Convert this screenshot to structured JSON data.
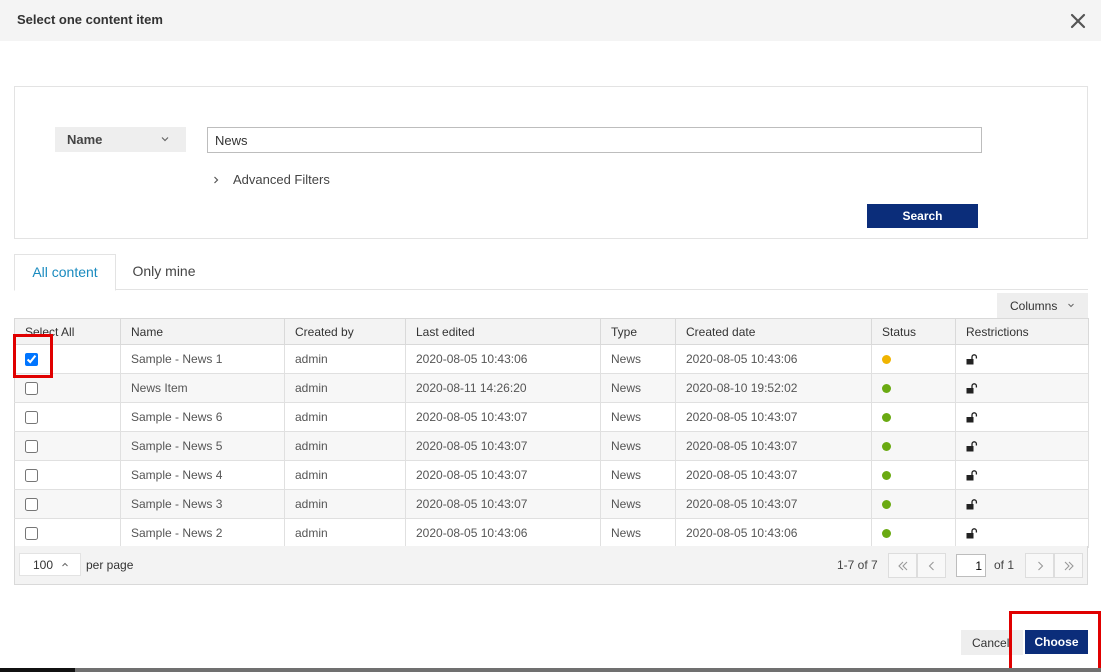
{
  "dialog": {
    "title": "Select one content item",
    "close_icon": "close-icon"
  },
  "filter": {
    "field_label": "Name",
    "search_value": "News",
    "advanced_filters_label": "Advanced Filters",
    "search_button_label": "Search"
  },
  "tabs": [
    {
      "label": "All content",
      "active": true
    },
    {
      "label": "Only mine",
      "active": false
    }
  ],
  "columns_button_label": "Columns",
  "table": {
    "headers": [
      "Select All",
      "Name",
      "Created by",
      "Last edited",
      "Type",
      "Created date",
      "Status",
      "Restrictions"
    ],
    "rows": [
      {
        "checked": true,
        "name": "Sample - News 1",
        "created_by": "admin",
        "last_edited": "2020-08-05 10:43:06",
        "type": "News",
        "created_date": "2020-08-05 10:43:06",
        "status_color": "#f0b400",
        "restriction_icon": "unlock-icon"
      },
      {
        "checked": false,
        "name": "News Item",
        "created_by": "admin",
        "last_edited": "2020-08-11 14:26:20",
        "type": "News",
        "created_date": "2020-08-10 19:52:02",
        "status_color": "#6aaa12",
        "restriction_icon": "unlock-icon"
      },
      {
        "checked": false,
        "name": "Sample - News 6",
        "created_by": "admin",
        "last_edited": "2020-08-05 10:43:07",
        "type": "News",
        "created_date": "2020-08-05 10:43:07",
        "status_color": "#6aaa12",
        "restriction_icon": "unlock-icon"
      },
      {
        "checked": false,
        "name": "Sample - News 5",
        "created_by": "admin",
        "last_edited": "2020-08-05 10:43:07",
        "type": "News",
        "created_date": "2020-08-05 10:43:07",
        "status_color": "#6aaa12",
        "restriction_icon": "unlock-icon"
      },
      {
        "checked": false,
        "name": "Sample - News 4",
        "created_by": "admin",
        "last_edited": "2020-08-05 10:43:07",
        "type": "News",
        "created_date": "2020-08-05 10:43:07",
        "status_color": "#6aaa12",
        "restriction_icon": "unlock-icon"
      },
      {
        "checked": false,
        "name": "Sample - News 3",
        "created_by": "admin",
        "last_edited": "2020-08-05 10:43:07",
        "type": "News",
        "created_date": "2020-08-05 10:43:07",
        "status_color": "#6aaa12",
        "restriction_icon": "unlock-icon"
      },
      {
        "checked": false,
        "name": "Sample - News 2",
        "created_by": "admin",
        "last_edited": "2020-08-05 10:43:06",
        "type": "News",
        "created_date": "2020-08-05 10:43:06",
        "status_color": "#6aaa12",
        "restriction_icon": "unlock-icon"
      }
    ]
  },
  "pager": {
    "per_page_value": "100",
    "per_page_label": "per page",
    "range_text": "1-7 of 7",
    "current_page": "1",
    "of_pages": "of 1"
  },
  "footer": {
    "cancel_label": "Cancel",
    "choose_label": "Choose"
  },
  "colors": {
    "primary": "#0b2d7a",
    "tab_active": "#1a8bbf",
    "highlight": "#e00000"
  }
}
